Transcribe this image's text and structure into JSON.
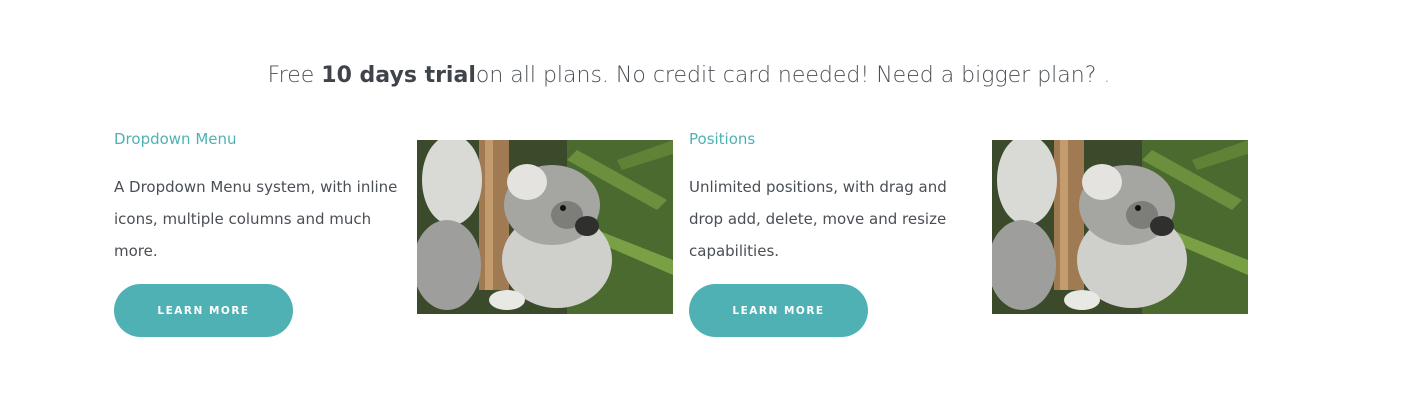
{
  "headline": {
    "prefix": "Free ",
    "bold": "10 days trial",
    "suffix": "on all plans. No credit card needed! Need a bigger plan? ",
    "link": "."
  },
  "features": [
    {
      "title": "Dropdown Menu",
      "description": "A Dropdown Menu system, with inline icons, multiple columns and much more.",
      "button_label": "LEARN MORE",
      "image_icon": "koala-photo"
    },
    {
      "title": "Positions",
      "description": "Unlimited positions, with drag and drop add, delete, move and resize capabilities.",
      "button_label": "LEARN MORE",
      "image_icon": "koala-photo"
    }
  ],
  "colors": {
    "accent": "#4fb1b4",
    "text": "#4a4f55"
  }
}
